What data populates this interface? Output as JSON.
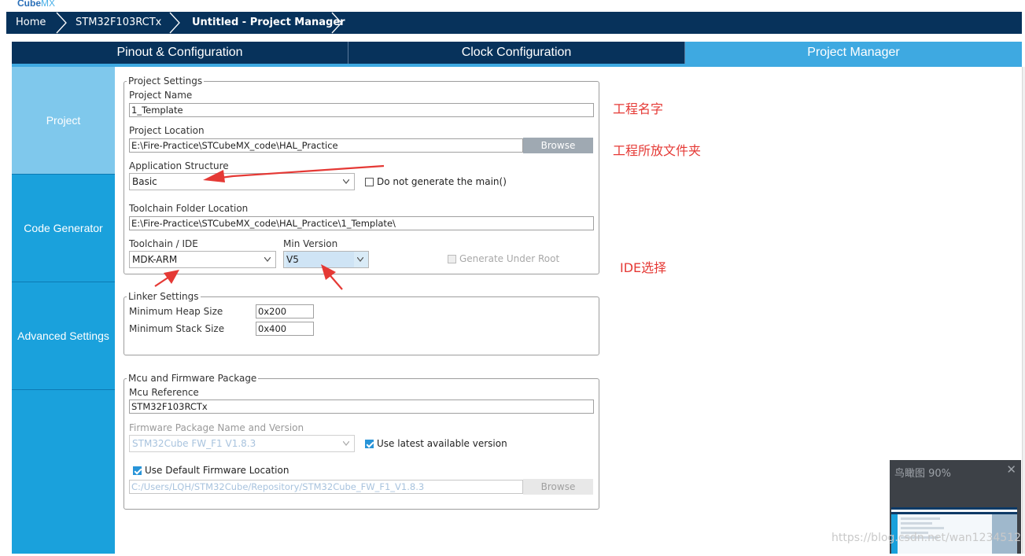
{
  "app": {
    "logo_main": "Cube",
    "logo_accent": "MX"
  },
  "breadcrumb": [
    {
      "label": "Home"
    },
    {
      "label": "STM32F103RCTx"
    },
    {
      "label": "Untitled - Project Manager"
    }
  ],
  "tabs": [
    {
      "label": "Pinout & Configuration"
    },
    {
      "label": "Clock Configuration"
    },
    {
      "label": "Project Manager",
      "active": true
    }
  ],
  "sidenav": [
    {
      "label": "Project",
      "active": true
    },
    {
      "label": "Code Generator"
    },
    {
      "label": "Advanced Settings"
    }
  ],
  "project_settings": {
    "legend": "Project Settings",
    "project_name_label": "Project Name",
    "project_name": "1_Template",
    "project_location_label": "Project Location",
    "project_location": "E:\\Fire-Practice\\STCubeMX_code\\HAL_Practice",
    "browse_label": "Browse",
    "app_structure_label": "Application Structure",
    "app_structure": "Basic",
    "no_main_label": "Do not generate the main()",
    "toolchain_folder_label": "Toolchain Folder Location",
    "toolchain_folder": "E:\\Fire-Practice\\STCubeMX_code\\HAL_Practice\\1_Template\\",
    "toolchain_label": "Toolchain / IDE",
    "toolchain": "MDK-ARM",
    "min_version_label": "Min Version",
    "min_version": "V5",
    "generate_under_root_label": "Generate Under Root"
  },
  "linker_settings": {
    "legend": "Linker Settings",
    "heap_label": "Minimum Heap Size",
    "heap": "0x200",
    "stack_label": "Minimum Stack Size",
    "stack": "0x400"
  },
  "mcu_firmware": {
    "legend": "Mcu and Firmware Package",
    "mcu_ref_label": "Mcu Reference",
    "mcu_ref": "STM32F103RCTx",
    "fw_label": "Firmware Package Name and Version",
    "fw": "STM32Cube FW_F1 V1.8.3",
    "use_latest_label": "Use latest available version",
    "use_default_label": "Use Default Firmware Location",
    "fw_location": "C:/Users/LQH/STM32Cube/Repository/STM32Cube_FW_F1_V1.8.3",
    "browse_label": "Browse"
  },
  "annotations": {
    "project_name_note": "工程名字",
    "location_note": "工程所放文件夹",
    "ide_note": "IDE选择"
  },
  "overview": {
    "title": "鸟瞰图 90%",
    "close": "✕"
  },
  "watermark": "https://blog.csdn.net/wan1234512",
  "colors": {
    "nav_dark": "#07325b",
    "accent": "#3ea9e1",
    "sidenav": "#1aa1dc",
    "annotation": "#e53935"
  }
}
